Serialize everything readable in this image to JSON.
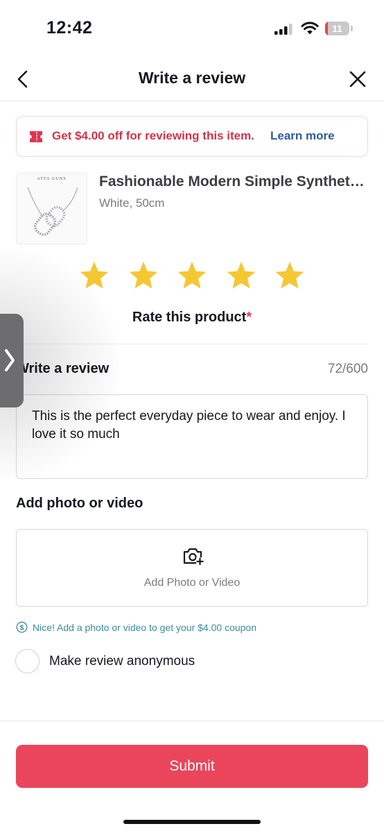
{
  "status_bar": {
    "time": "12:42",
    "battery_level": "11",
    "battery_fraction": 0.11
  },
  "header": {
    "title": "Write a review",
    "back_icon": "chevron-left-icon",
    "close_icon": "close-icon"
  },
  "promo": {
    "text": "Get $4.00 off for reviewing this item.",
    "link": "Learn more",
    "icon": "coupon-icon",
    "text_color": "#d2334a",
    "link_color": "#2d5d9c"
  },
  "product": {
    "thumbnail_brand": "ATTA·GUNS",
    "name": "Fashionable Modern Simple Synthetic Diamond Necklace",
    "variant": "White, 50cm"
  },
  "rating": {
    "stars_selected": 5,
    "stars_total": 5,
    "label": "Rate this product",
    "required_mark": "*",
    "star_color": "#f5c733"
  },
  "review": {
    "label": "Write a review",
    "count": "72/600",
    "text": "This is the perfect everyday piece to wear and enjoy. I love it so much"
  },
  "media": {
    "label": "Add photo or video",
    "button_label": "Add Photo or Video",
    "icon": "camera-plus-icon"
  },
  "tip": {
    "text": "Nice! Add a photo or video to get your $4.00 coupon",
    "icon": "dollar-circle-icon",
    "color": "#3a8c9e"
  },
  "anonymous": {
    "label": "Make review anonymous",
    "checked": false
  },
  "submit": {
    "label": "Submit",
    "color": "#eb455c"
  },
  "side_tab": {
    "glyph": "❯"
  }
}
